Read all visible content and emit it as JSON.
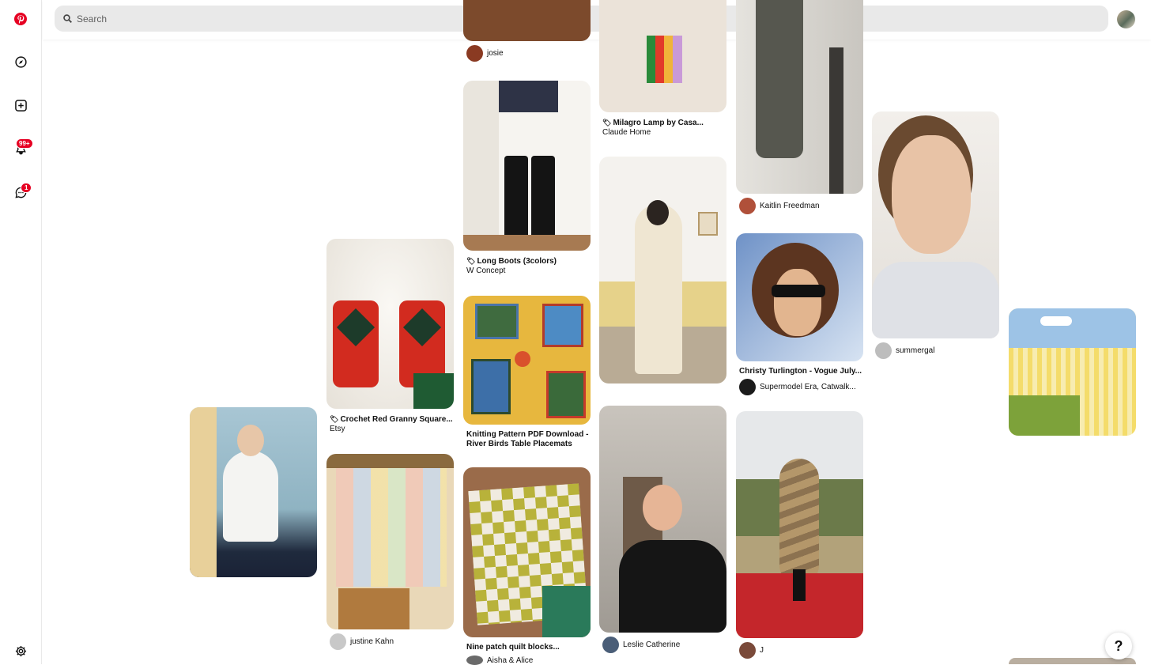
{
  "search": {
    "placeholder": "Search"
  },
  "sidebar": {
    "notifications_badge": "99+",
    "messages_badge": "1"
  },
  "pins": [
    {
      "creator": "josie"
    },
    {
      "title": "Milagro Lamp by Casa...",
      "subtitle": "Claude Home"
    },
    {
      "creator": "Kaitlin Freedman"
    },
    {
      "title": "Long Boots (3colors)",
      "subtitle": "W Concept"
    },
    {
      "creator": "summergal"
    },
    {
      "title": "Christy Turlington - Vogue July...",
      "creator": "Supermodel Era, Catwalk..."
    },
    {
      "title": "Crochet Red Granny Square...",
      "subtitle": "Etsy"
    },
    {
      "title": "Knitting Pattern PDF Download - River Birds Table Placemats"
    },
    {
      "creator": "justine Kahn"
    },
    {
      "title": "Nine patch quilt blocks...",
      "creator": "Aisha & Alice"
    },
    {
      "creator": "Leslie Catherine"
    },
    {
      "creator": "J"
    }
  ],
  "help": {
    "label": "?"
  },
  "tag_icon": "tag-icon",
  "accent": "#e60023"
}
